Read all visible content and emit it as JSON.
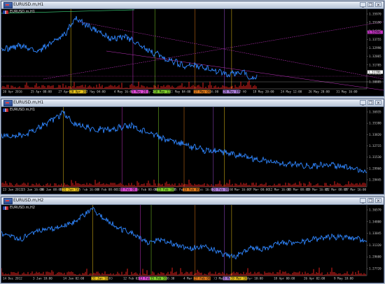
{
  "colors": {
    "background": "#000000",
    "price_line": "#2f86ff",
    "volume": "#e0201c",
    "magenta": "#c033c0",
    "green": "#7fcf2a",
    "orange": "#e07a1a",
    "yellow": "#e8c21a",
    "purple": "#9b4bd0"
  },
  "windows": [
    {
      "title": "EURUSD.m,H1",
      "inner_label": "EURUSD.m,H1",
      "price_labels": [
        "1.35970",
        "1.35190",
        "1.34395",
        "1.33755",
        "1.32998",
        "1.32065",
        "1.31785",
        "1.31310",
        "1.30885"
      ],
      "price_labels_highlight": [
        "1.32906",
        "1.31786"
      ],
      "time_labels": [
        "20 Apr 2016",
        "25 Apr 08:00",
        "27 Apr 20:00",
        "2 May 04:00",
        "4 May 16:00",
        "6 May 20:00",
        "11 May 04:00",
        "13 May 16:00",
        "17 May 12:00",
        "19 May 20:00",
        "24 May 12:00",
        "26 May 20:00",
        "31 May 16:00"
      ],
      "time_tags": [
        {
          "text": "28 Apr 16:00",
          "color": "#e8c21a"
        },
        {
          "text": "5 May 20:00",
          "color": "#e04ad8"
        },
        {
          "text": "10 May 12:00",
          "color": "#7fcf2a"
        },
        {
          "text": "17 May 00:00",
          "color": "#e07a1a"
        },
        {
          "text": "20 May 08:00",
          "color": "#b080e0"
        }
      ]
    },
    {
      "title": "EURUSD.m,H1",
      "inner_label": "EURUSD.m,H1",
      "price_labels": [
        "1.36935",
        "1.35380",
        "1.33820",
        "1.32715",
        "1.31530",
        "1.29960",
        "1.29445"
      ],
      "time_labels": [
        "23 Jan 2013",
        "25 Jan 16:00",
        "30 Jan 08:00",
        "1 Feb 00:00",
        "5 Feb 16:00",
        "8 Feb 08:00",
        "11 Feb 16:00",
        "14 Feb 00:00",
        "18 Feb 16:00",
        "21 Feb 00:00",
        "25 Feb 16:00",
        "28 Feb 08:00",
        "4 Mar 16:00",
        "7 Mar 00:00",
        "12 Mar 16:00",
        "15 Mar 08:00",
        "19 Mar 16:00",
        "22 Mar 08:00",
        "27 Mar 16:00"
      ],
      "time_tags": [
        {
          "text": "31 Jan 16:00",
          "color": "#e8c21a"
        },
        {
          "text": "8 Feb 00:00",
          "color": "#e04ad8"
        },
        {
          "text": "15 Feb 16:00",
          "color": "#7fcf2a"
        },
        {
          "text": "19 Feb 00:00",
          "color": "#e07a1a"
        },
        {
          "text": "26 Feb 00:00",
          "color": "#b080e0"
        }
      ]
    },
    {
      "title": "EURUSD.m,H2",
      "inner_label": "EURUSD.m,H2",
      "price_labels": [
        "1.36570",
        "1.34800",
        "1.33045",
        "1.31320",
        "1.29600",
        "1.27720"
      ],
      "time_labels": [
        "14 Dec 2012",
        "3 Jan 18:00",
        "14 Jan 02:00",
        "1 Feb 00:00",
        "12 Feb 02:00",
        "21 Feb 08:00",
        "4 Mar 20:00",
        "13 Mar 16:00",
        "1 Apr 10:00",
        "18 Apr 00:00",
        "26 Apr 02:00",
        "9 May 18:00"
      ],
      "time_tags": [
        {
          "text": "31 Jan 16:00",
          "color": "#e8c21a"
        },
        {
          "text": "13 Feb 00:00",
          "color": "#e04ad8"
        },
        {
          "text": "15 Feb 16:00",
          "color": "#7fcf2a"
        },
        {
          "text": "27 Feb 08:00",
          "color": "#e07a1a"
        },
        {
          "text": "8 Mar 12:00",
          "color": "#b080e0"
        },
        {
          "text": "19 Mar 16:00",
          "color": "#e8c21a"
        }
      ]
    }
  ],
  "window_buttons": [
    "minimize-icon",
    "restore-icon",
    "close-icon"
  ]
}
